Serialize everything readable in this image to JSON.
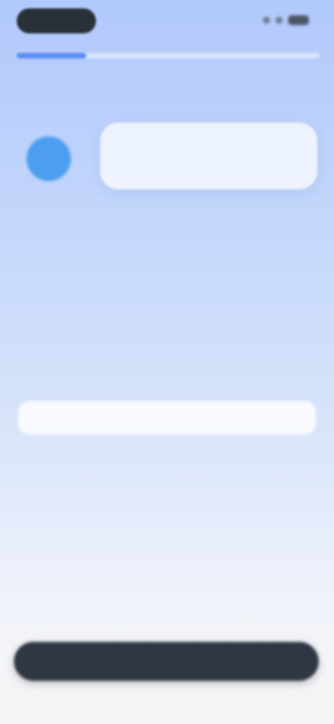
{
  "status_bar": {
    "pill_color": "#2a3038"
  },
  "progress": {
    "fraction": 0.23,
    "fill_color": "#5b8ff2"
  },
  "chat": {
    "avatar_color": "#4b9ef0",
    "bubble_lines": [
      "",
      ""
    ]
  },
  "picker": {
    "items_above": [
      "",
      ""
    ],
    "selected": "",
    "items_below": [
      "",
      ""
    ]
  },
  "footer": {
    "continue_label": ""
  }
}
